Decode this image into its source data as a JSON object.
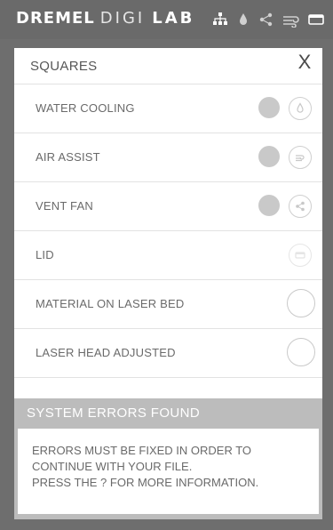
{
  "header": {
    "brand_part1": "DREMEL",
    "brand_part2": "DIGI",
    "brand_part3": "LAB",
    "icons": [
      "network-icon",
      "water-drop-icon",
      "share-icon",
      "fan-icon",
      "lid-icon"
    ]
  },
  "dialog": {
    "title": "SQUARES",
    "close_label": "X",
    "items": [
      {
        "label": "WATER COOLING",
        "icon": "water-drop-icon"
      },
      {
        "label": "AIR ASSIST",
        "icon": "air-icon"
      },
      {
        "label": "VENT FAN",
        "icon": "fan-icon"
      },
      {
        "label": "LID",
        "icon": "lid-icon"
      },
      {
        "label": "MATERIAL ON LASER BED",
        "icon": "empty-circle-icon"
      },
      {
        "label": "LASER HEAD ADJUSTED",
        "icon": "empty-circle-icon"
      }
    ]
  },
  "errors": {
    "title": "SYSTEM ERRORS FOUND",
    "line1": "ERRORS MUST BE FIXED IN ORDER TO",
    "line2": "CONTINUE WITH YOUR FILE.",
    "line3": "PRESS THE ? FOR MORE INFORMATION."
  }
}
